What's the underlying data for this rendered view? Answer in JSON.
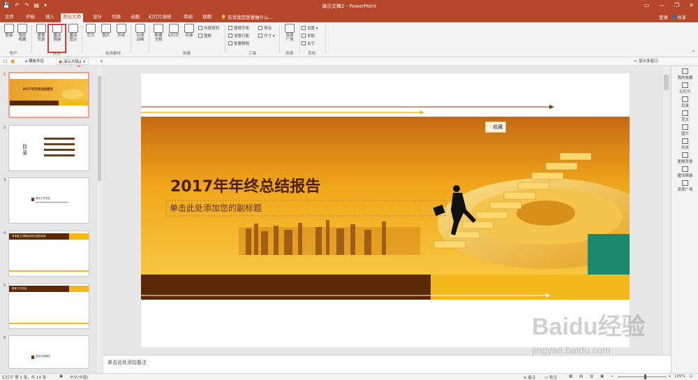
{
  "titlebar": {
    "doc_title": "演示文稿2 - PowerPoint",
    "quick_access": [
      "💾",
      "↶",
      "↷",
      "▤",
      "▾"
    ],
    "window_controls": [
      "▭",
      "—",
      "❐",
      "✕"
    ]
  },
  "tabs": [
    "文件",
    "开始",
    "插入",
    "美化大师",
    "设计",
    "切换",
    "动画",
    "幻灯片放映",
    "审阅",
    "视图"
  ],
  "tell_me": "告诉我您想要做什么...",
  "account": {
    "login": "登录",
    "share": "共享"
  },
  "ribbon": {
    "large": [
      {
        "name": "login",
        "label": "登录"
      },
      {
        "name": "my-favorites",
        "label": "我的\n收藏"
      },
      {
        "name": "change-background",
        "label": "更换\n背景"
      },
      {
        "name": "magic-replace",
        "label": "魔法\n换装"
      },
      {
        "name": "magic-show",
        "label": "魔法\n图示"
      },
      {
        "name": "fanwen",
        "label": "范文"
      },
      {
        "name": "picture",
        "label": "图片"
      },
      {
        "name": "shape",
        "label": "形状"
      },
      {
        "name": "online-animation",
        "label": "在线\n动画"
      },
      {
        "name": "new-document",
        "label": "新建\n文档"
      },
      {
        "name": "slide",
        "label": "幻灯片"
      },
      {
        "name": "toc",
        "label": "目录"
      },
      {
        "name": "resource-square",
        "label": "资源\n广场"
      }
    ],
    "small": [
      {
        "name": "content-plan",
        "label": "内容规划"
      },
      {
        "name": "album",
        "label": "图册"
      },
      {
        "name": "replace-font",
        "label": "替换字体"
      },
      {
        "name": "export",
        "label": "导出"
      },
      {
        "name": "set-line-spacing",
        "label": "设置行距"
      },
      {
        "name": "size",
        "label": "尺寸 ▾"
      },
      {
        "name": "batch-delete",
        "label": "批量删除"
      },
      {
        "name": "settings",
        "label": "设置 ▾"
      },
      {
        "name": "help",
        "label": "求助"
      },
      {
        "name": "about",
        "label": "关于"
      }
    ],
    "groups": [
      "账户",
      "美化",
      "在线素材",
      "新建",
      "工具",
      "资源",
      "其他"
    ]
  },
  "doc_tabs": {
    "template": "模板专区",
    "current": "演示文稿2",
    "show_multi": "显示多窗口"
  },
  "slides": {
    "numbers": [
      "1",
      "2",
      "3",
      "4",
      "5",
      "6"
    ],
    "t1": "2017年年终总结报告",
    "t2": "目 录",
    "t3": "单击工作总结",
    "t4": "本年度工作概括及所达成的目标",
    "t5": "具体工作总结",
    "t6": "目标达成情况"
  },
  "slide": {
    "title": "2017年年终总结报告",
    "subtitle": "单击此处添加您的副标题",
    "favorite": "收藏"
  },
  "notes": "单击此处添加备注",
  "right_panel": [
    "我的收藏",
    "幻灯片",
    "目录",
    "范文",
    "图片",
    "形状",
    "更换背景",
    "魔法换装",
    "资源广场"
  ],
  "status": {
    "slide_info": "幻灯片 第 1 张，共 14 张",
    "language": "中文(中国)",
    "notes": "备注",
    "comments": "批注",
    "zoom": "105%"
  },
  "watermark": {
    "brand": "Baidu经验",
    "url": "jingyan.baidu.com"
  },
  "colors": {
    "accent": "#b7472a",
    "highlight": "#e03a3a",
    "slide_gold": "#f1a81a",
    "slide_brown": "#5a2a05"
  }
}
